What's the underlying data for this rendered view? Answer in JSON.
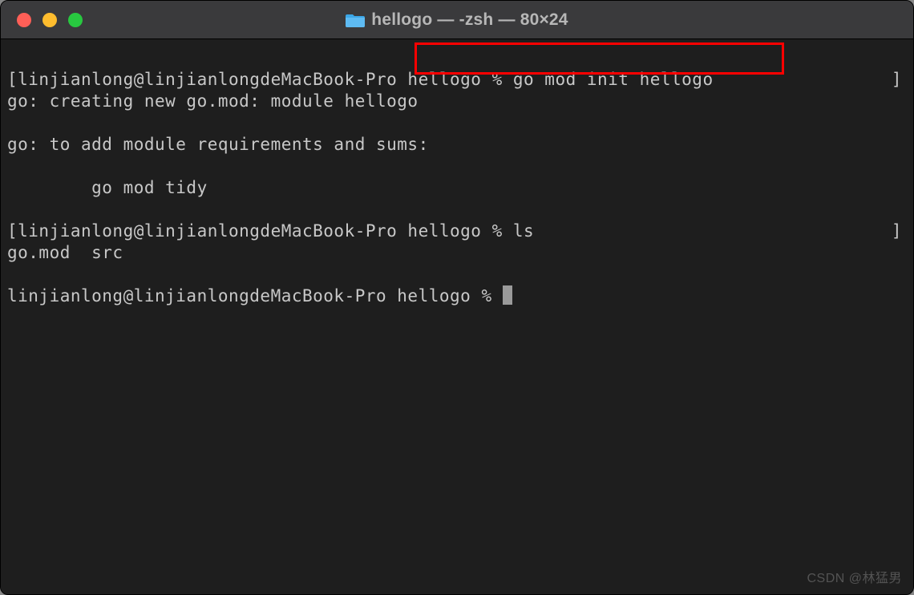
{
  "window": {
    "title": "hellogo — -zsh — 80×24"
  },
  "terminal": {
    "lines": {
      "l1_prompt": "[linjianlong@linjianlongdeMacBook-Pro hellogo % ",
      "l1_cmd": "go mod init hellogo",
      "l1_end": "]",
      "l2": "go: creating new go.mod: module hellogo",
      "l3": "go: to add module requirements and sums:",
      "l4": "        go mod tidy",
      "l5_prompt": "[linjianlong@linjianlongdeMacBook-Pro hellogo % ",
      "l5_cmd": "ls",
      "l5_end": "]",
      "l6": "go.mod  src",
      "l7_prompt": "linjianlong@linjianlongdeMacBook-Pro hellogo % "
    }
  },
  "watermark": "CSDN @林猛男"
}
